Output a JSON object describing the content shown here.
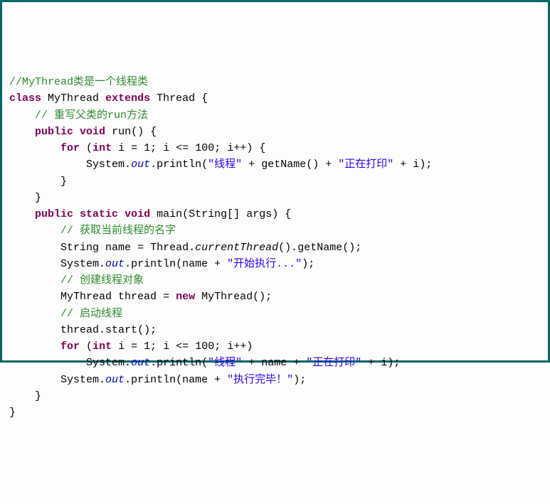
{
  "code": {
    "c1": "//MyThread类是一个线程类",
    "kw_class": "class",
    "cls": "MyThread",
    "kw_extends": "extends",
    "sup": "Thread",
    "c2": "// 重写父类的run方法",
    "kw_public": "public",
    "kw_void": "void",
    "m_run": "run",
    "kw_for": "for",
    "kw_int": "int",
    "id_i": "i",
    "n1": "1",
    "n100": "100",
    "sys": "System",
    "out": "out",
    "pln": "println",
    "s_thread": "\"线程\"",
    "getName": "getName",
    "s_printing": "\"正在打印\"",
    "kw_static": "static",
    "m_main": "main",
    "ty_string": "String",
    "id_args": "args",
    "c3": "// 获取当前线程的名字",
    "id_name": "name",
    "cls_thread": "Thread",
    "currentThread": "currentThread",
    "s_start": "\"开始执行...\"",
    "c4": "// 创建线程对象",
    "id_thread": "thread",
    "kw_new": "new",
    "c5": "// 启动线程",
    "m_start": "start",
    "s_done": "\"执行完毕！\""
  }
}
